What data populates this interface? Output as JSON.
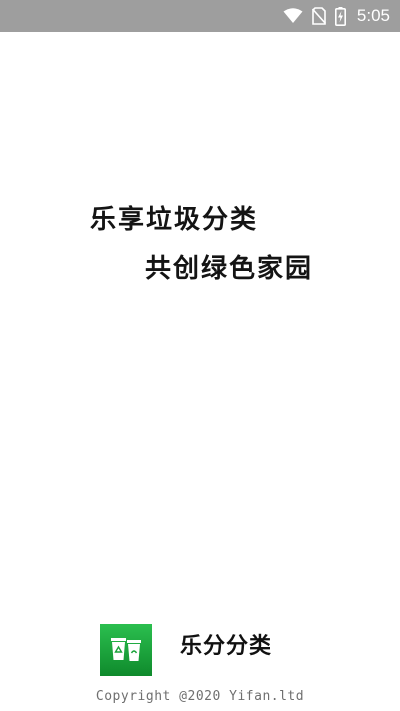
{
  "status_bar": {
    "time": "5:05",
    "icons": [
      "wifi-icon",
      "no-sim-icon",
      "battery-charging-icon"
    ]
  },
  "splash": {
    "slogan_line1": "乐享垃圾分类",
    "slogan_line2": "共创绿色家园"
  },
  "footer": {
    "app_name": "乐分分类",
    "logo_icon": "recycle-bin-icon",
    "copyright": "Copyright @2020 Yifan.ltd"
  },
  "colors": {
    "status_bar_bg": "#9e9e9e",
    "logo_green": "#1aa33a",
    "text_dark": "#141414"
  }
}
